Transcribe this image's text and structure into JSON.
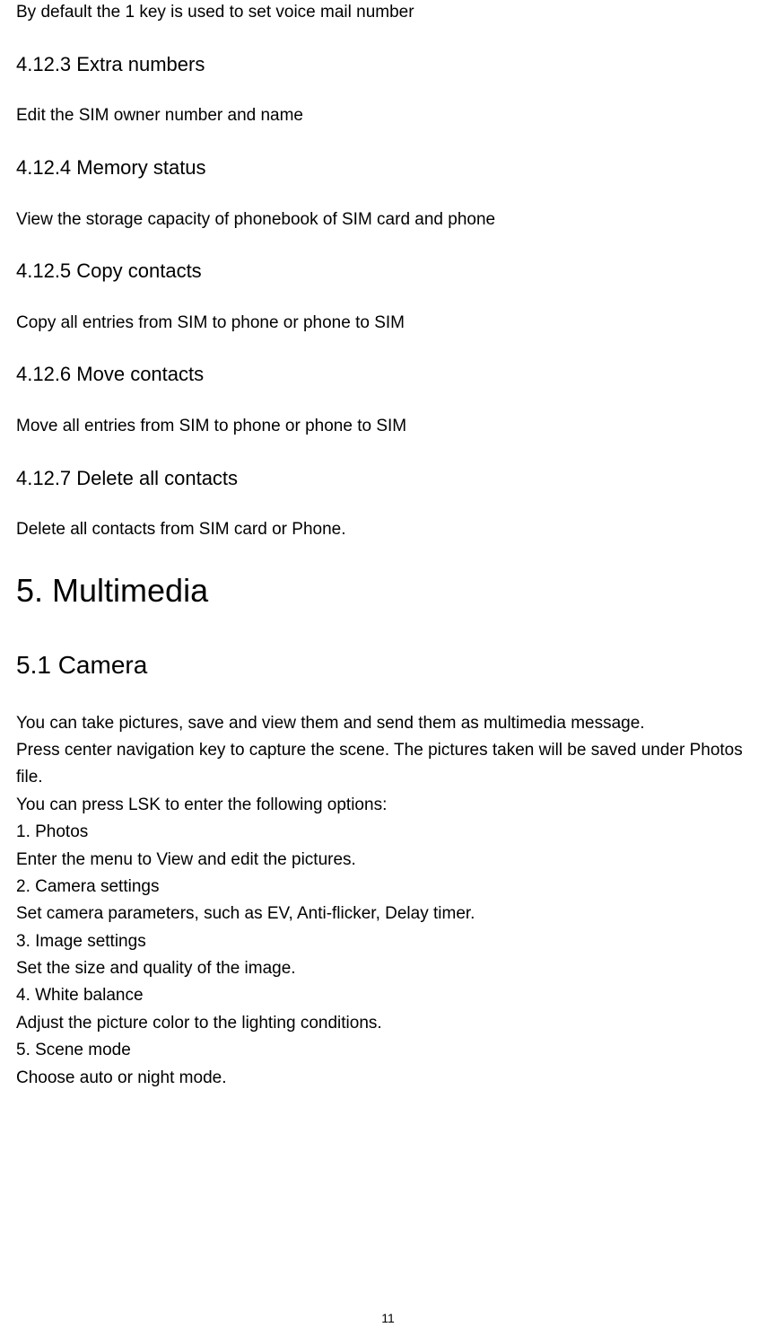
{
  "sections": {
    "intro": "By default the 1 key is used to set voice mail number",
    "s4_12_3": {
      "heading": "4.12.3 Extra numbers",
      "body": "Edit the SIM owner number and name"
    },
    "s4_12_4": {
      "heading": "4.12.4 Memory status",
      "body": "View the storage capacity of phonebook of SIM card and phone"
    },
    "s4_12_5": {
      "heading": "4.12.5 Copy contacts",
      "body": "Copy all entries from SIM to phone or phone to SIM"
    },
    "s4_12_6": {
      "heading": "4.12.6 Move contacts",
      "body": "Move all entries from SIM to phone or phone to SIM"
    },
    "s4_12_7": {
      "heading": "4.12.7 Delete all contacts",
      "body": "Delete all contacts from SIM card or Phone."
    },
    "s5": {
      "heading": "5. Multimedia"
    },
    "s5_1": {
      "heading": "5.1 Camera",
      "p1": "You can take pictures, save and view them and send them as multimedia message.",
      "p2": "Press center navigation key to capture the scene. The pictures taken will be saved under Photos file.",
      "p3": "You can press LSK to enter the following options:",
      "opt1_title": "1. Photos",
      "opt1_body": "Enter the menu to View and edit the pictures.",
      "opt2_title": "2. Camera settings",
      "opt2_body": "Set camera parameters, such as EV, Anti-flicker, Delay timer.",
      "opt3_title": "3. Image settings",
      "opt3_body": "Set the size and quality of the image.",
      "opt4_title": "4. White balance",
      "opt4_body": "Adjust the picture color to the lighting conditions.",
      "opt5_title": "5. Scene mode",
      "opt5_body": "Choose auto or night mode."
    }
  },
  "page_number": "11"
}
